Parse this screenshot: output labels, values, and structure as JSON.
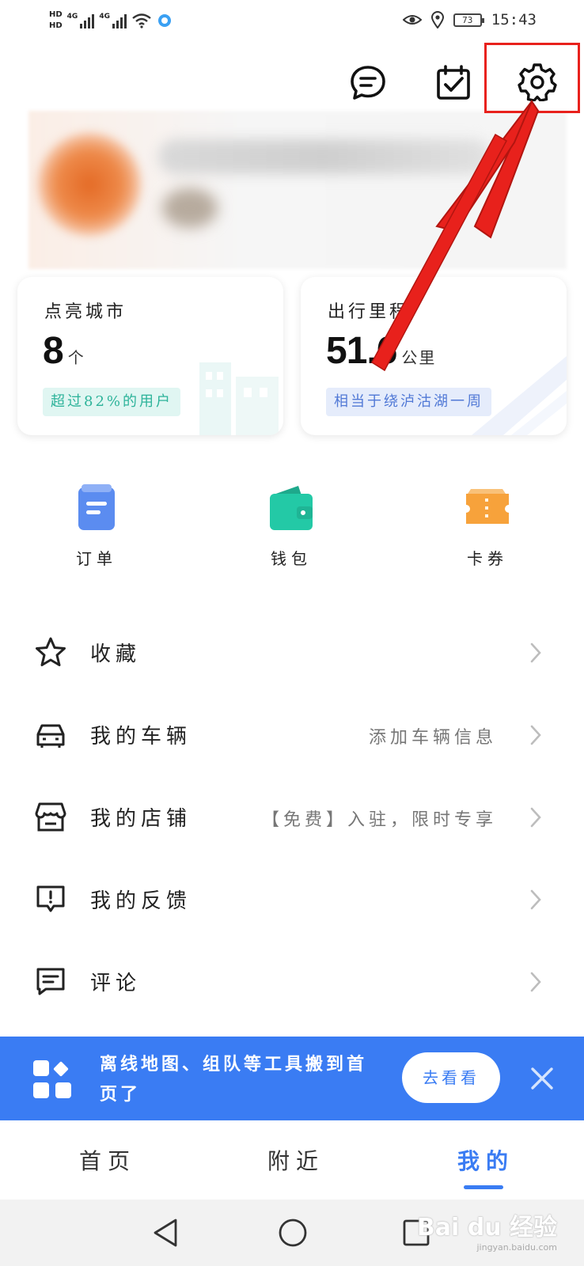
{
  "status_bar": {
    "hd1": "HD",
    "hd2": "HD",
    "net1": "4G",
    "net2": "4G",
    "battery": "73",
    "time": "15:43"
  },
  "top_actions": {
    "message_icon": "message-icon",
    "checkin_icon": "calendar-check-icon",
    "settings_icon": "gear-icon"
  },
  "stats": {
    "cities": {
      "title": "点亮城市",
      "value": "8",
      "unit": "个",
      "tag": "超过82%的用户"
    },
    "mileage": {
      "title": "出行里程",
      "value": "51.6",
      "unit": "公里",
      "tag": "相当于绕泸沽湖一周"
    }
  },
  "quick_entries": [
    {
      "label": "订单",
      "icon": "order-icon",
      "color": "#5b8cf0"
    },
    {
      "label": "钱包",
      "icon": "wallet-icon",
      "color": "#23c9a6"
    },
    {
      "label": "卡券",
      "icon": "coupon-icon",
      "color": "#f7a23b"
    }
  ],
  "menu": [
    {
      "label": "收藏",
      "hint": "",
      "icon": "star-icon"
    },
    {
      "label": "我的车辆",
      "hint": "添加车辆信息",
      "icon": "car-icon"
    },
    {
      "label": "我的店铺",
      "hint": "【免费】入驻，限时专享",
      "icon": "store-icon"
    },
    {
      "label": "我的反馈",
      "hint": "",
      "icon": "feedback-icon"
    },
    {
      "label": "评论",
      "hint": "",
      "icon": "comment-icon"
    }
  ],
  "banner": {
    "text": "离线地图、组队等工具搬到首页了",
    "button": "去看看",
    "icon": "apps-grid-icon"
  },
  "bottom_nav": {
    "tabs": [
      "首页",
      "附近",
      "我的"
    ],
    "active": "我的"
  },
  "watermark": {
    "main": "Bai du 经验",
    "sub": "jingyan.baidu.com"
  },
  "colors": {
    "accent": "#3a7cf3",
    "annotation": "#e8211c"
  }
}
